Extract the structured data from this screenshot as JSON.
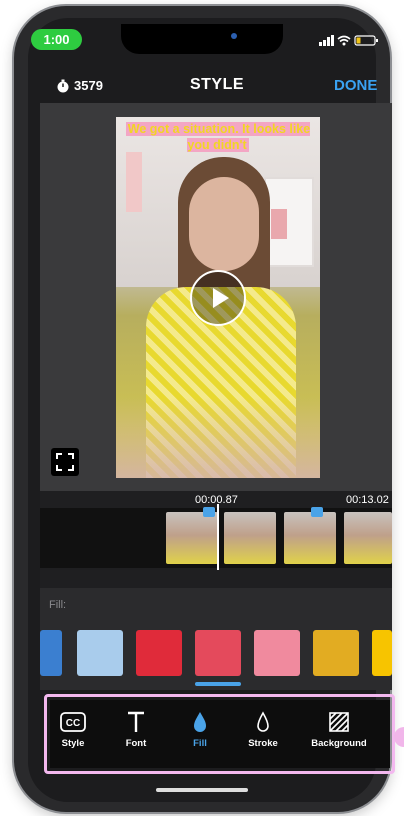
{
  "status_bar": {
    "time": "1:00"
  },
  "header": {
    "count": "3579",
    "title": "STYLE",
    "done_label": "DONE"
  },
  "video": {
    "caption": "We got a situation. It looks like you didn't"
  },
  "timeline": {
    "current_time": "00:00.87",
    "end_time": "00:13.02"
  },
  "fill_panel": {
    "label": "Fill:",
    "swatches": [
      "#3b7fd0",
      "#a9ccec",
      "#e02b3a",
      "#e44a5c",
      "#f08a9e",
      "#e2ac22",
      "#f7c400"
    ]
  },
  "toolbar": {
    "tabs": [
      {
        "label": "Style",
        "icon": "cc-icon"
      },
      {
        "label": "Font",
        "icon": "text-icon"
      },
      {
        "label": "Fill",
        "icon": "droplet-filled-icon",
        "active": true
      },
      {
        "label": "Stroke",
        "icon": "droplet-outline-icon"
      },
      {
        "label": "Background",
        "icon": "hatch-icon"
      }
    ],
    "accent": "#4aa3e8"
  }
}
